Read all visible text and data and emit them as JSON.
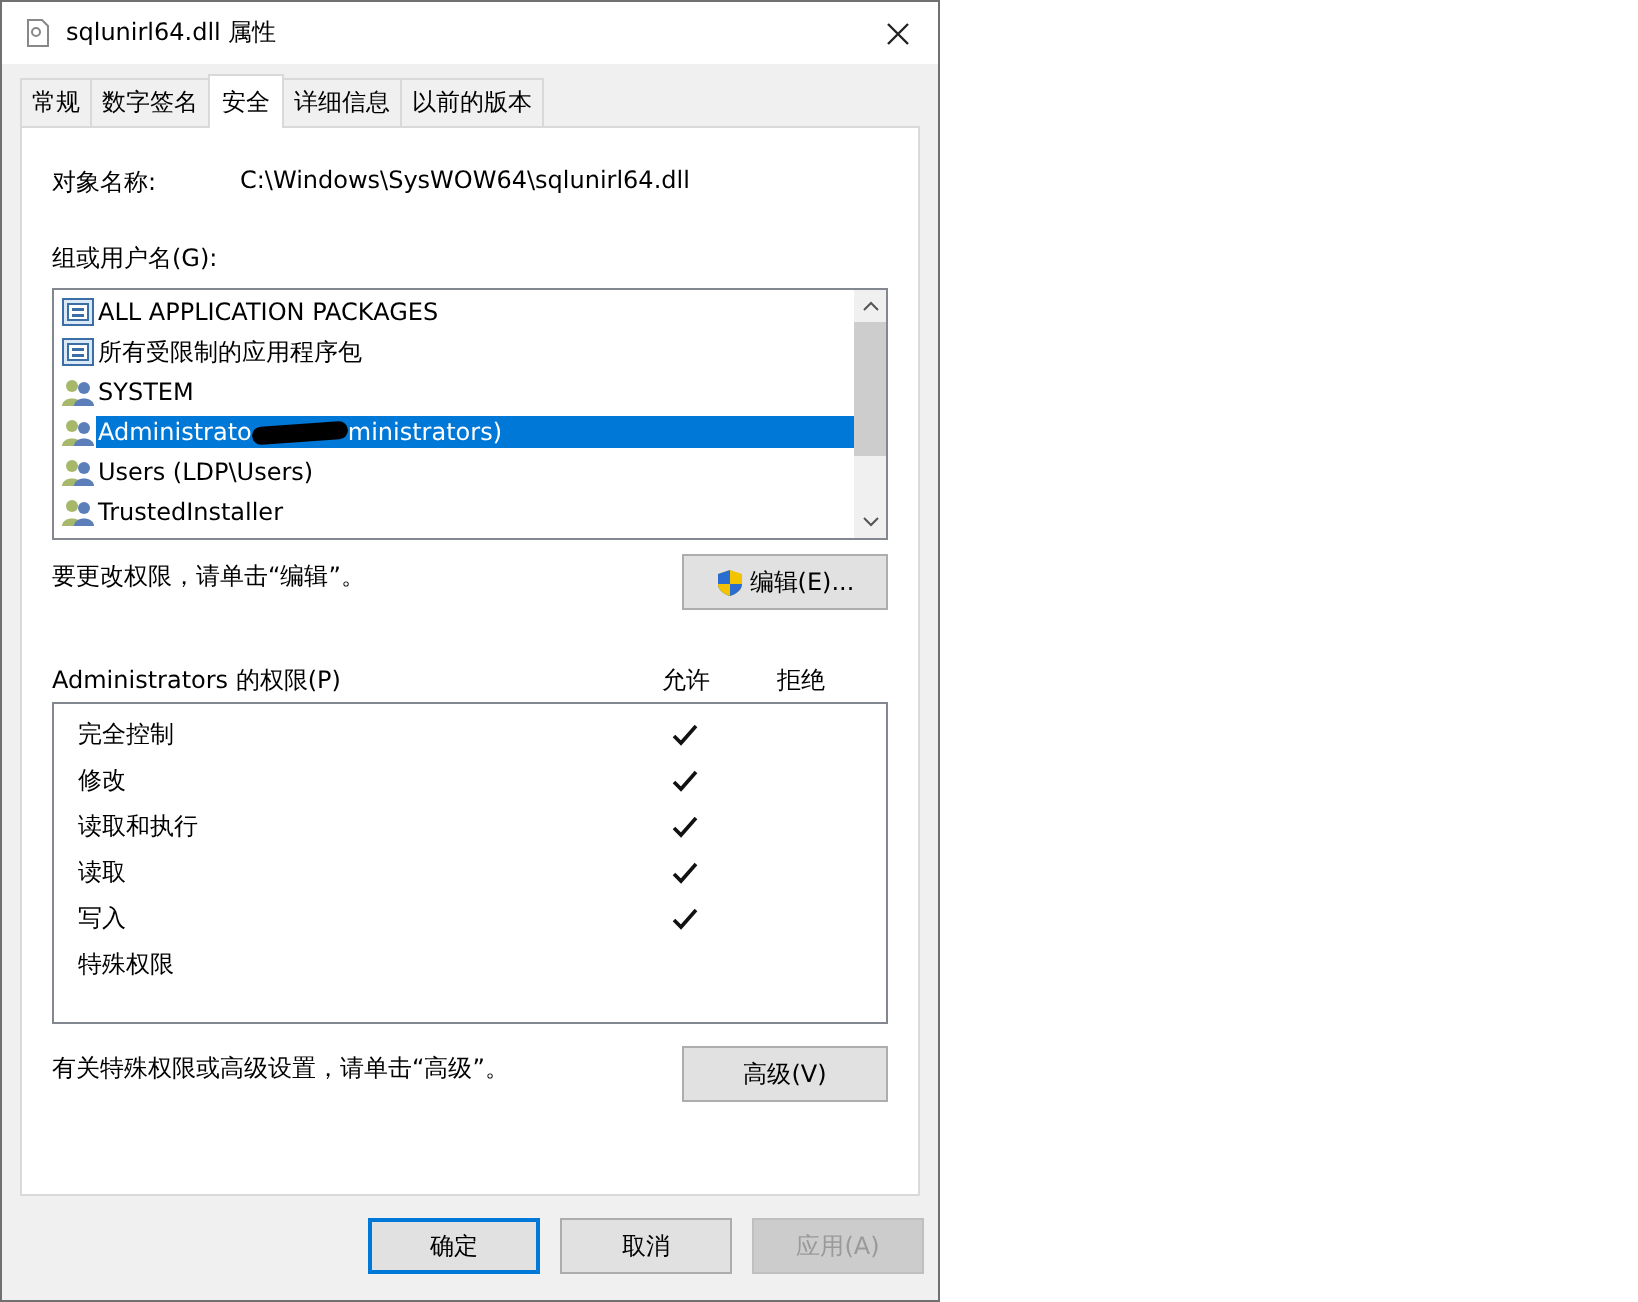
{
  "window": {
    "title": "sqlunirl64.dll 属性"
  },
  "tabs": [
    {
      "label": "常规",
      "selected": false
    },
    {
      "label": "数字签名",
      "selected": false
    },
    {
      "label": "安全",
      "selected": true
    },
    {
      "label": "详细信息",
      "selected": false
    },
    {
      "label": "以前的版本",
      "selected": false
    }
  ],
  "object_name": {
    "label": "对象名称:",
    "value": "C:\\Windows\\SysWOW64\\sqlunirl64.dll"
  },
  "groups": {
    "label": "组或用户名(G):",
    "items": [
      {
        "kind": "package",
        "label": "ALL APPLICATION PACKAGES",
        "selected": false
      },
      {
        "kind": "package",
        "label": "所有受限制的应用程序包",
        "selected": false
      },
      {
        "kind": "user",
        "label": "SYSTEM",
        "selected": false
      },
      {
        "kind": "redacted",
        "label": "Administrato",
        "label_end": "ministrators)",
        "selected": true
      },
      {
        "kind": "user",
        "label": "Users (LDP\\Users)",
        "selected": false
      },
      {
        "kind": "user",
        "label": "TrustedInstaller",
        "selected": false
      }
    ]
  },
  "edit_hint": "要更改权限，请单击“编辑”。",
  "edit_button": "编辑(E)...",
  "permissions": {
    "label": "Administrators 的权限(P)",
    "allow_header": "允许",
    "deny_header": "拒绝",
    "rows": [
      {
        "label": "完全控制",
        "allow": true,
        "deny": false
      },
      {
        "label": "修改",
        "allow": true,
        "deny": false
      },
      {
        "label": "读取和执行",
        "allow": true,
        "deny": false
      },
      {
        "label": "读取",
        "allow": true,
        "deny": false
      },
      {
        "label": "写入",
        "allow": true,
        "deny": false
      },
      {
        "label": "特殊权限",
        "allow": false,
        "deny": false
      }
    ]
  },
  "advanced_hint": "有关特殊权限或高级设置，请单击“高级”。",
  "advanced_button": "高级(V)",
  "buttons": [
    {
      "label": "确定",
      "default": true,
      "disabled": false
    },
    {
      "label": "取消",
      "default": false,
      "disabled": false
    },
    {
      "label": "应用(A)",
      "default": false,
      "disabled": true
    }
  ]
}
